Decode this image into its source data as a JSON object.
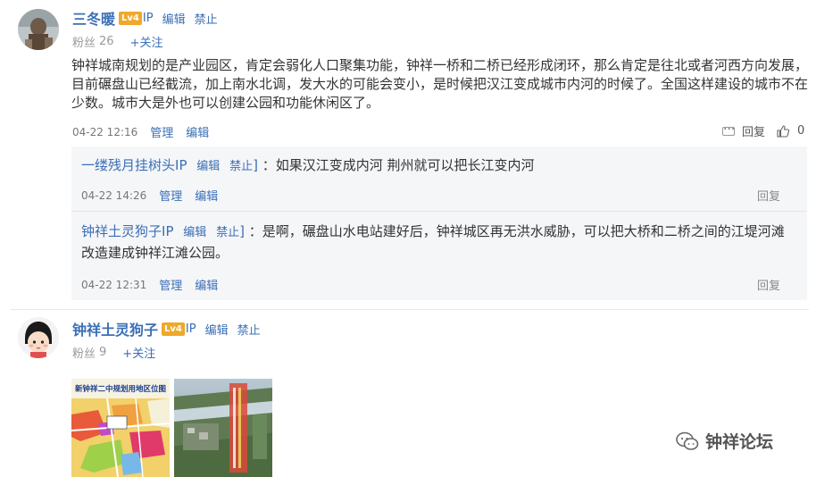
{
  "post1": {
    "username": "三冬暖",
    "level": "Lv4",
    "ip": "IP",
    "edit_label": "编辑",
    "ban_label": "禁止",
    "fans_label": "粉丝",
    "fans_count": "26",
    "follow_label": "+关注",
    "content": "钟祥城南规划的是产业园区，肯定会弱化人口聚集功能，钟祥一桥和二桥已经形成闭环，那么肯定是往北或者河西方向发展，目前碾盘山已经截流，加上南水北调，发大水的可能会变小，是时候把汉江变成城市内河的时候了。全国这样建设的城市不在少数。城市大是外也可以创建公园和功能休闲区了。",
    "time": "04-22 12:16",
    "manage_label": "管理",
    "edit_link": "编辑",
    "reply_label": "回复",
    "like_count": "0",
    "replies": [
      {
        "user": "一缕残月挂树头",
        "ip": "IP",
        "edit": "编辑",
        "ban": "禁止",
        "text": "：如果汉江变成内河 荆州就可以把长江变内河",
        "time": "04-22 14:26",
        "manage": "管理",
        "edit_link": "编辑",
        "reply": "回复"
      },
      {
        "user": "钟祥土灵狗子",
        "ip": "IP",
        "edit": "编辑",
        "ban": "禁止",
        "text": "：是啊，碾盘山水电站建好后，钟祥城区再无洪水威胁，可以把大桥和二桥之间的江堤河滩改造建成钟祥江滩公园。",
        "time": "04-22 12:31",
        "manage": "管理",
        "edit_link": "编辑",
        "reply": "回复"
      }
    ]
  },
  "post2": {
    "username": "钟祥土灵狗子",
    "level": "Lv4",
    "ip": "IP",
    "edit_label": "编辑",
    "ban_label": "禁止",
    "fans_label": "粉丝",
    "fans_count": "9",
    "follow_label": "+关注",
    "thumb1_title": "新钟祥二中规划用地区位图"
  },
  "watermark": {
    "text": "钟祥论坛",
    "icon": "wechat-icon"
  },
  "colors": {
    "link": "#3b6fb6",
    "badge": "#f0a82b",
    "sub_bg": "#f5f6f8"
  }
}
